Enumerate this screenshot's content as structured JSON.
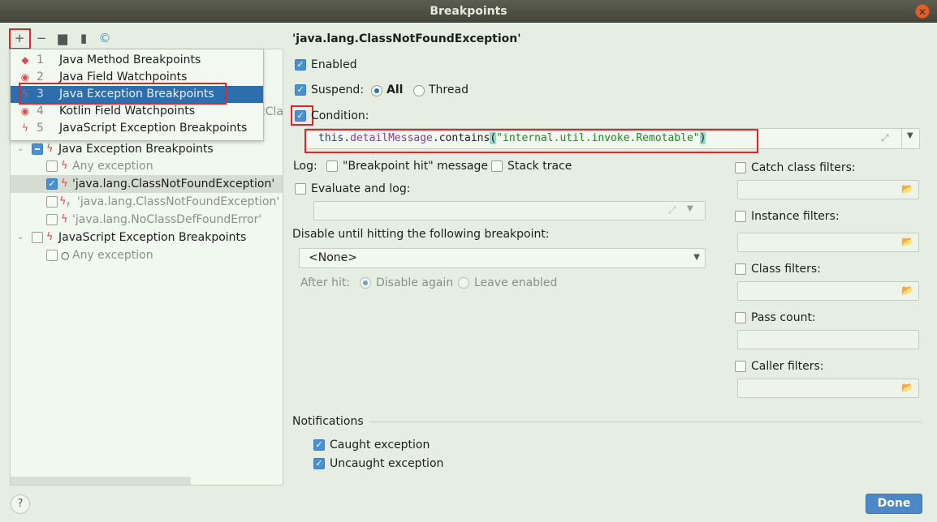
{
  "window": {
    "title": "Breakpoints"
  },
  "toolbar": {
    "add": "+",
    "remove": "−"
  },
  "popup": {
    "items": [
      {
        "num": "1",
        "label": "Java Method Breakpoints",
        "icon": "diamond-icon"
      },
      {
        "num": "2",
        "label": "Java Field Watchpoints",
        "icon": "eye-icon"
      },
      {
        "num": "3",
        "label": "Java Exception Breakpoints",
        "icon": "bolt-icon",
        "selected": true
      },
      {
        "num": "4",
        "label": "Kotlin Field Watchpoints",
        "icon": "eye-icon"
      },
      {
        "num": "5",
        "label": "JavaScript Exception Breakpoints",
        "icon": "bolt-icon"
      }
    ]
  },
  "tree": {
    "items": [
      {
        "label": "Java Exception Breakpoints",
        "state": "mixed"
      },
      {
        "label": "Any exception",
        "checked": false
      },
      {
        "label": "'java.lang.ClassNotFoundException'",
        "checked": true,
        "selected": true
      },
      {
        "label": "'java.lang.ClassNotFoundException'",
        "checked": false
      },
      {
        "label": "'java.lang.NoClassDefFoundError'",
        "checked": false
      },
      {
        "label": "JavaScript Exception Breakpoints",
        "checked": false
      },
      {
        "label": "Any exception",
        "checked": false
      }
    ],
    "hidden_fragment": "cCla"
  },
  "detail": {
    "title": "'java.lang.ClassNotFoundException'",
    "enabled": "Enabled",
    "enabled_checked": true,
    "suspend": "Suspend:",
    "suspend_all": "All",
    "suspend_thread": "Thread",
    "suspend_value": "All",
    "condition": "Condition:",
    "condition_checked": true,
    "condition_code": {
      "kw": "this",
      "dot1": ".",
      "field": "detailMessage",
      "method": ".contains",
      "lp": "(",
      "str": "\"internal.util.invoke.Remotable\"",
      "rp": ")"
    },
    "log": "Log:",
    "log_message": "\"Breakpoint hit\" message",
    "stack_trace": "Stack trace",
    "evaluate_log": "Evaluate and log:",
    "disable_until": "Disable until hitting the following breakpoint:",
    "disable_select": "<None>",
    "after_hit": "After hit:",
    "disable_again": "Disable again",
    "leave_enabled": "Leave enabled",
    "filters": [
      "Catch class filters:",
      "Instance filters:",
      "Class filters:",
      "Pass count:",
      "Caller filters:"
    ],
    "notifications": "Notifications",
    "caught": "Caught exception",
    "uncaught": "Uncaught exception"
  },
  "footer": {
    "help": "?",
    "done": "Done"
  },
  "colors": {
    "accent": "#2d6fae",
    "highlight": "#e0262b",
    "bg": "#e6eee3"
  }
}
